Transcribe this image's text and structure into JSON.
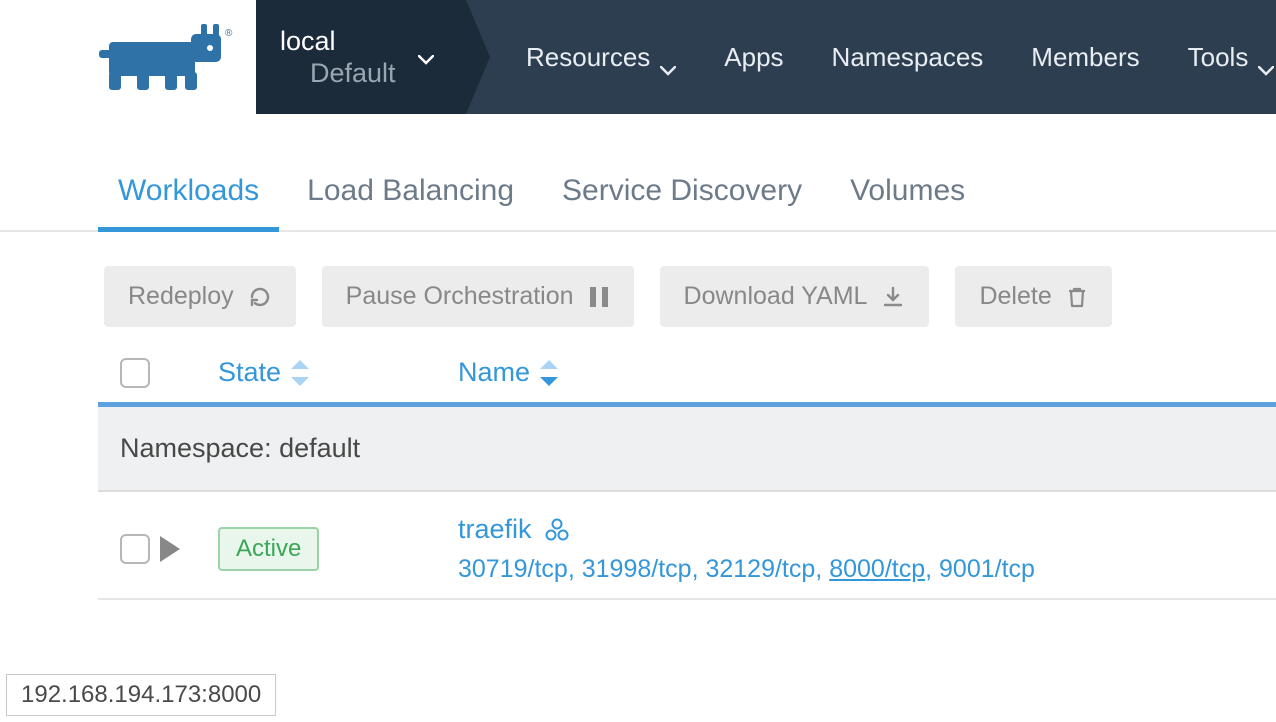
{
  "header": {
    "cluster": {
      "name": "local",
      "project": "Default"
    },
    "nav": {
      "resources": "Resources",
      "apps": "Apps",
      "namespaces": "Namespaces",
      "members": "Members",
      "tools": "Tools"
    }
  },
  "tabs": {
    "workloads": "Workloads",
    "load_balancing": "Load Balancing",
    "service_discovery": "Service Discovery",
    "volumes": "Volumes"
  },
  "toolbar": {
    "redeploy": "Redeploy",
    "pause": "Pause Orchestration",
    "download": "Download YAML",
    "delete": "Delete"
  },
  "table": {
    "columns": {
      "state": "State",
      "name": "Name"
    },
    "namespace_label": "Namespace: default",
    "rows": [
      {
        "state": "Active",
        "name": "traefik",
        "ports": [
          {
            "text": "30719/tcp",
            "underline": false
          },
          {
            "text": "31998/tcp",
            "underline": false
          },
          {
            "text": "32129/tcp",
            "underline": false
          },
          {
            "text": "8000/tcp",
            "underline": true
          },
          {
            "text": "9001/tcp",
            "underline": false
          }
        ]
      }
    ]
  },
  "statusbar": "192.168.194.173:8000"
}
